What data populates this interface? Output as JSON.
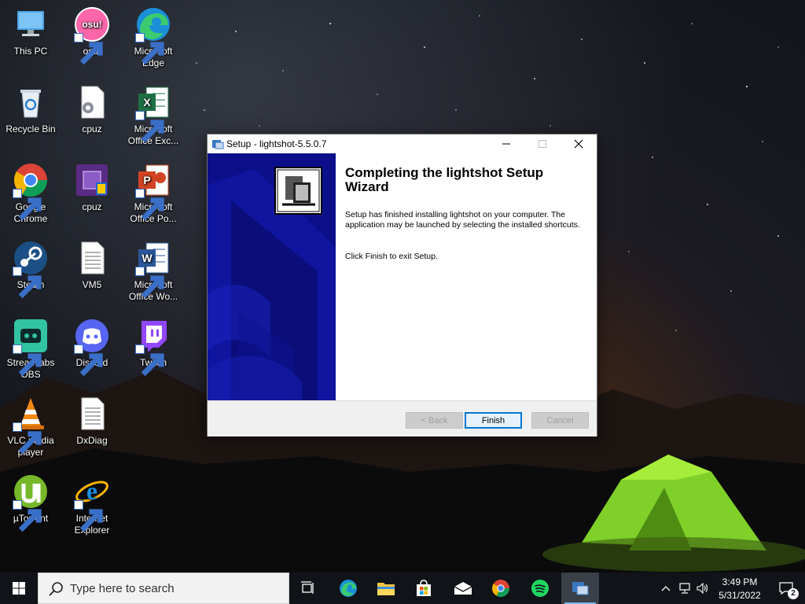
{
  "desktop": {
    "icons": [
      {
        "label": "This PC"
      },
      {
        "label": "osu!"
      },
      {
        "label": "Microsoft Edge"
      },
      {
        "label": "Recycle Bin"
      },
      {
        "label": "cpuz"
      },
      {
        "label": "Microsoft Office Exc..."
      },
      {
        "label": "Google Chrome"
      },
      {
        "label": "cpuz"
      },
      {
        "label": "Microsoft Office Po..."
      },
      {
        "label": "Steam"
      },
      {
        "label": "VM5"
      },
      {
        "label": "Microsoft Office Wo..."
      },
      {
        "label": "Streamlabs OBS"
      },
      {
        "label": "Discord"
      },
      {
        "label": "Twitch"
      },
      {
        "label": "VLC media player"
      },
      {
        "label": "DxDiag"
      },
      {
        "label": "µTorrent"
      },
      {
        "label": "Internet Explorer"
      }
    ],
    "osu_text": "osu!"
  },
  "window": {
    "title": "Setup - lightshot-5.5.0.7",
    "heading": "Completing the lightshot Setup Wizard",
    "paragraph1": "Setup has finished installing lightshot on your computer. The application may be launched by selecting the installed shortcuts.",
    "paragraph2": "Click Finish to exit Setup.",
    "buttons": {
      "back": "< Back",
      "finish": "Finish",
      "cancel": "Cancel"
    }
  },
  "taskbar": {
    "search_placeholder": "Type here to search",
    "time": "3:49 PM",
    "date": "5/31/2022",
    "notifications": "2"
  },
  "colors": {
    "banner_blue": "#0c0f8a",
    "accent": "#0078d7",
    "taskbar": "#101318"
  }
}
